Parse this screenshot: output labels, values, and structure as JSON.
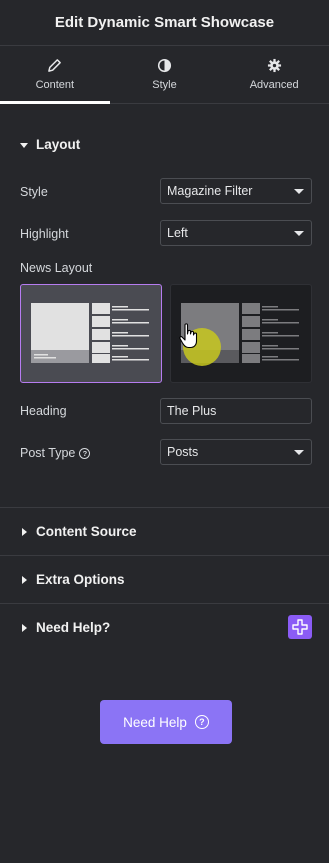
{
  "header": {
    "title": "Edit Dynamic Smart Showcase"
  },
  "tabs": [
    {
      "label": "Content",
      "icon": "pencil-icon"
    },
    {
      "label": "Style",
      "icon": "half-circle-icon"
    },
    {
      "label": "Advanced",
      "icon": "gear-icon"
    }
  ],
  "layout_section": {
    "title": "Layout",
    "style": {
      "label": "Style",
      "value": "Magazine Filter"
    },
    "highlight": {
      "label": "Highlight",
      "value": "Left"
    },
    "news_layout": {
      "label": "News Layout"
    },
    "heading": {
      "label": "Heading",
      "value": "The Plus"
    },
    "post_type": {
      "label": "Post Type",
      "value": "Posts"
    }
  },
  "sections": {
    "content_source": "Content Source",
    "extra_options": "Extra Options",
    "need_help": "Need Help?"
  },
  "help_button": {
    "label": "Need Help"
  },
  "colors": {
    "background": "#26272b",
    "accent": "#8b74f5",
    "selected_border": "#b67cf0"
  }
}
